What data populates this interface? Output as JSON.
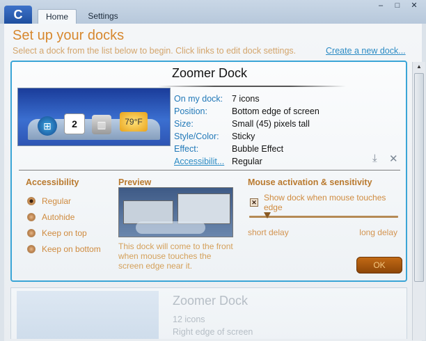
{
  "tabs": {
    "home": "Home",
    "settings": "Settings"
  },
  "window_buttons": {
    "minimize": "–",
    "maximize": "□",
    "close": "✕"
  },
  "header": {
    "title": "Set up your docks",
    "subtitle": "Select a dock from the list below to begin. Click links to edit dock settings.",
    "create_link": "Create a new dock..."
  },
  "selected_dock": {
    "name": "Zoomer Dock",
    "thumbnail_date": "2",
    "thumbnail_temp": "79°F",
    "props": [
      {
        "label": "On my dock:",
        "value": "7 icons"
      },
      {
        "label": "Position:",
        "value": "Bottom edge of screen"
      },
      {
        "label": "Size:",
        "value": "Small (45) pixels tall"
      },
      {
        "label": "Style/Color:",
        "value": "Sticky"
      },
      {
        "label": "Effect:",
        "value": "Bubble Effect"
      },
      {
        "label": "Accessibilit...",
        "value": "Regular"
      }
    ]
  },
  "accessibility": {
    "title": "Accessibility",
    "options": [
      "Regular",
      "Autohide",
      "Keep on top",
      "Keep on bottom"
    ],
    "selected": "Regular"
  },
  "preview": {
    "title": "Preview",
    "note": "This dock will come to the front when mouse touches the screen edge near it."
  },
  "mouse": {
    "title": "Mouse activation & sensitivity",
    "checkbox_label": "Show dock when mouse touches edge",
    "checked": true,
    "slider_min_label": "short delay",
    "slider_max_label": "long delay",
    "slider_value_fraction": 0.12
  },
  "ok_label": "OK",
  "second_dock": {
    "name": "Zoomer Dock",
    "lines": [
      "12 icons",
      "Right edge of screen"
    ]
  }
}
